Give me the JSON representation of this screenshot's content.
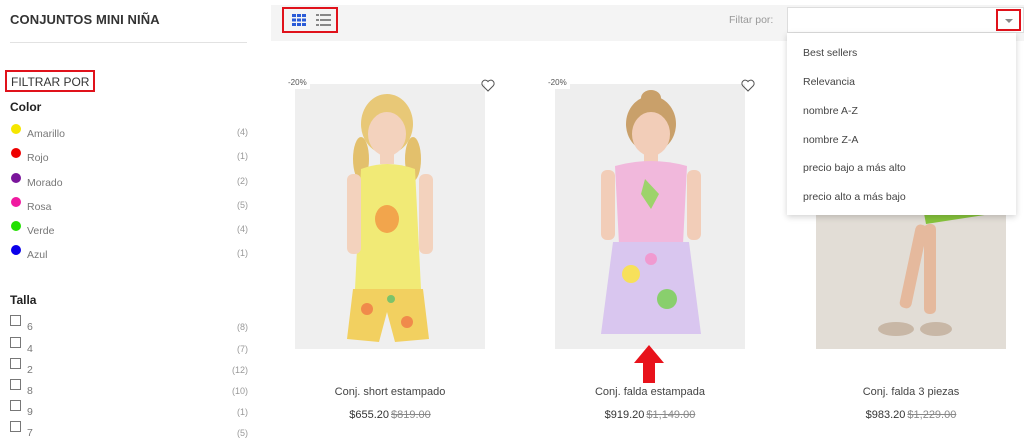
{
  "sidebar": {
    "category_title": "CONJUNTOS MINI NIÑA",
    "filter_title": "FILTRAR POR",
    "color_group": {
      "title": "Color",
      "items": [
        {
          "label": "Amarillo",
          "count": "(4)",
          "color": "#f5e600"
        },
        {
          "label": "Rojo",
          "count": "(1)",
          "color": "#ee0000"
        },
        {
          "label": "Morado",
          "count": "(2)",
          "color": "#7a159b"
        },
        {
          "label": "Rosa",
          "count": "(5)",
          "color": "#f01aa0"
        },
        {
          "label": "Verde",
          "count": "(4)",
          "color": "#22e000"
        },
        {
          "label": "Azul",
          "count": "(1)",
          "color": "#0b00ea"
        }
      ]
    },
    "size_group": {
      "title": "Talla",
      "items": [
        {
          "label": "6",
          "count": "(8)"
        },
        {
          "label": "4",
          "count": "(7)"
        },
        {
          "label": "2",
          "count": "(12)"
        },
        {
          "label": "8",
          "count": "(10)"
        },
        {
          "label": "9",
          "count": "(1)"
        },
        {
          "label": "7",
          "count": "(5)"
        }
      ]
    }
  },
  "toolbar": {
    "view_grid_icon": "grid-view-icon",
    "view_list_icon": "list-view-icon",
    "filter_label": "Filtar por:",
    "select_value": "",
    "caret_icon": "chevron-down-icon"
  },
  "sort_dropdown": {
    "options": [
      "Best sellers",
      "Relevancia",
      "nombre A-Z",
      "nombre Z-A",
      "precio bajo a más alto",
      "precio alto a más bajo"
    ]
  },
  "products": [
    {
      "badge": "-20%",
      "name": "Conj. short estampado",
      "price": "$655.20",
      "old_price": "$819.00"
    },
    {
      "badge": "-20%",
      "name": "Conj. falda estampada",
      "price": "$919.20",
      "old_price": "$1,149.00"
    },
    {
      "badge": "",
      "name": "Conj. falda 3 piezas",
      "price": "$983.20",
      "old_price": "$1,229.00"
    }
  ],
  "colors": {
    "highlight": "#e0121b",
    "toolbar_bg": "#f4f4f4",
    "active_view": "#2a5bd7"
  }
}
